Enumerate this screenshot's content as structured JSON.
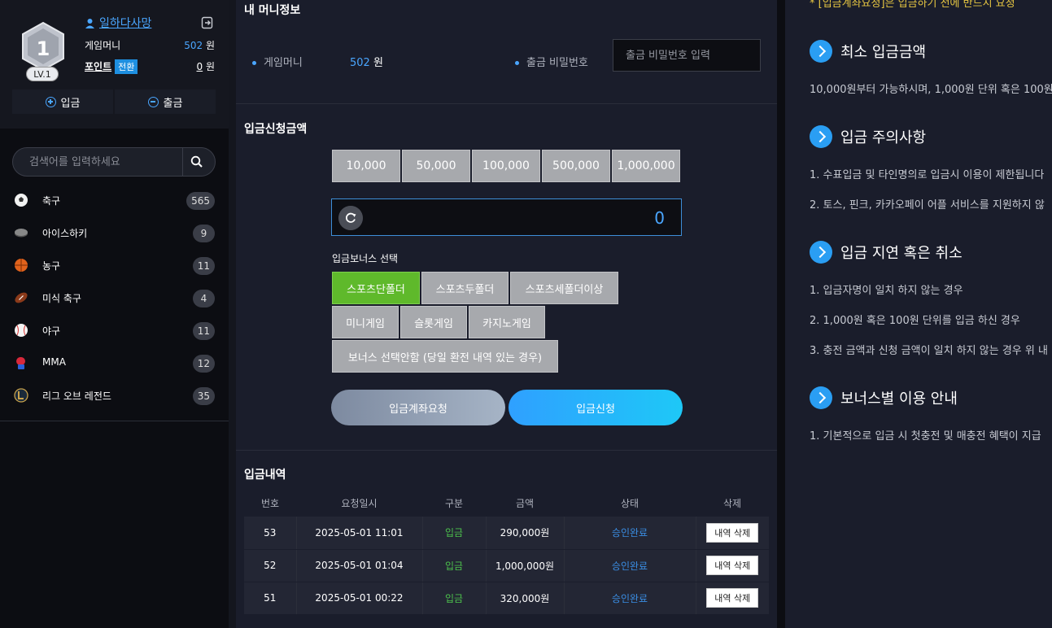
{
  "profile": {
    "level_number": "1",
    "level_label": "LV.1",
    "username": "일하다사망",
    "game_money_label": "게임머니",
    "game_money_value": "502",
    "game_money_unit": "원",
    "point_label": "포인트",
    "switch_label": "전환",
    "point_value": "0",
    "point_unit": "원",
    "deposit_label": "입금",
    "withdraw_label": "출금"
  },
  "search": {
    "placeholder": "검색어를 입력하세요"
  },
  "sports": [
    {
      "name": "축구",
      "count": "565",
      "icon": "soccer-ball-icon"
    },
    {
      "name": "아이스하키",
      "count": "9",
      "icon": "hockey-puck-icon"
    },
    {
      "name": "농구",
      "count": "11",
      "icon": "basketball-icon"
    },
    {
      "name": "미식 축구",
      "count": "4",
      "icon": "american-football-icon"
    },
    {
      "name": "야구",
      "count": "11",
      "icon": "baseball-icon"
    },
    {
      "name": "MMA",
      "count": "12",
      "icon": "boxing-glove-icon"
    },
    {
      "name": "리그 오브 레전드",
      "count": "35",
      "icon": "league-of-legends-icon"
    }
  ],
  "money_info": {
    "title": "내 머니정보",
    "game_money_label": "게임머니",
    "game_money_value": "502",
    "game_money_unit": "원",
    "withdraw_pw_label": "출금 비밀번호",
    "withdraw_pw_placeholder": "출금 비밀번호 입력"
  },
  "deposit_request": {
    "title": "입금신청금액",
    "amounts": [
      "10,000",
      "50,000",
      "100,000",
      "500,000",
      "1,000,000"
    ],
    "amount_value": "0",
    "bonus_label": "입금보너스 선택",
    "bonus_options": [
      "스포츠단폴더",
      "스포츠두폴더",
      "스포츠세폴더이상",
      "미니게임",
      "슬롯게임",
      "카지노게임",
      "보너스 선택안함 (당일 환전 내역 있는 경우)"
    ],
    "selected_bonus": "스포츠단폴더",
    "account_request_label": "입금계좌요청",
    "submit_label": "입금신청"
  },
  "history": {
    "title": "입금내역",
    "columns": [
      "번호",
      "요청일시",
      "구분",
      "금액",
      "상태",
      "삭제"
    ],
    "rows": [
      {
        "no": "53",
        "date": "2025-05-01 11:01",
        "type": "입금",
        "amount": "290,000원",
        "status": "승인완료",
        "action": "내역 삭제"
      },
      {
        "no": "52",
        "date": "2025-05-01 01:04",
        "type": "입금",
        "amount": "1,000,000원",
        "status": "승인완료",
        "action": "내역 삭제"
      },
      {
        "no": "51",
        "date": "2025-05-01 00:22",
        "type": "입금",
        "amount": "320,000원",
        "status": "승인완료",
        "action": "내역 삭제"
      }
    ]
  },
  "info": {
    "notice_top": "* [입금계좌요청]은 입금하기 전에 반드시 요청",
    "sections": [
      {
        "title": "최소 입금금액",
        "lines": [
          "10,000원부터 가능하시며, 1,000원 단위 혹은 100원"
        ]
      },
      {
        "title": "입금 주의사항",
        "lines": [
          "1. 수표입금 및 타인명의로 입금시 이용이 제한됩니다",
          "2. 토스, 핀크, 카카오페이 어플 서비스를 지원하지 않"
        ]
      },
      {
        "title": "입금 지연 혹은 취소",
        "lines": [
          "1. 입금자명이 일치 하지 않는 경우",
          "2. 1,000원 혹은 100원 단위를 입금 하신 경우",
          "3. 충전 금액과 신청 금액이 일치 하지 않는 경우 위 내"
        ]
      },
      {
        "title": "보너스별 이용 안내",
        "lines": [
          "1. 기본적으로 입금 시 첫충전 및 매충전 혜택이 지급"
        ]
      }
    ]
  },
  "colors": {
    "accent_blue": "#4aa6ff",
    "bonus_active": "#5fb92b",
    "status_done": "#3a8de3",
    "type_deposit": "#4cc14c",
    "notice_yellow": "#e5c542"
  }
}
